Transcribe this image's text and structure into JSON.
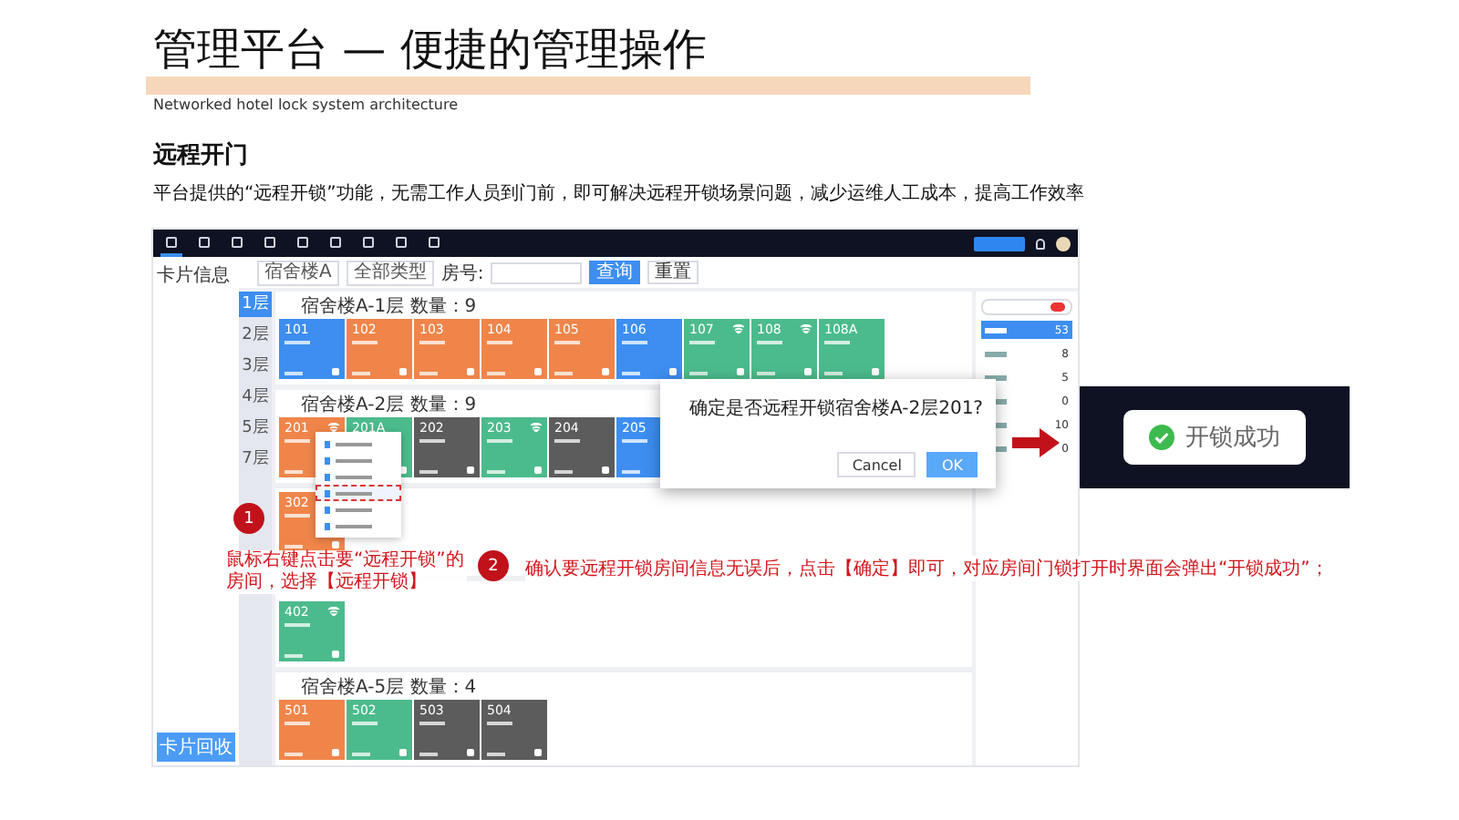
{
  "slide": {
    "title": "管理平台 — 便捷的管理操作",
    "subtitle": "Networked hotel lock system architecture",
    "section_title": "远程开门",
    "description": "平台提供的“远程开锁”功能，无需工作人员到门前，即可解决远程开锁场景问题，减少运维人工成本，提高工作效率"
  },
  "app": {
    "nav_items": [
      {
        "selected": true
      },
      {
        "selected": false
      },
      {
        "selected": false
      },
      {
        "selected": false
      },
      {
        "selected": false
      },
      {
        "selected": false
      },
      {
        "selected": false
      },
      {
        "selected": false
      },
      {
        "selected": false
      }
    ],
    "panel_label": "卡片信息",
    "bottom_button": "卡片回收",
    "filters": {
      "building": "宿舍楼A",
      "type": "全部类型",
      "room_label": "房号:",
      "search_button": "查询",
      "reset_button": "重置"
    },
    "floor_tabs": [
      {
        "label": "1层",
        "selected": true
      },
      {
        "label": "2层",
        "selected": false
      },
      {
        "label": "3层",
        "selected": false
      },
      {
        "label": "4层",
        "selected": false
      },
      {
        "label": "5层",
        "selected": false
      },
      {
        "label": "7层",
        "selected": false
      }
    ],
    "floors": [
      {
        "header": "宿舍楼A-1层 数量：9",
        "rooms": [
          {
            "number": "101",
            "color": "#3d8ef0",
            "wifi": false
          },
          {
            "number": "102",
            "color": "#f0854a",
            "wifi": false
          },
          {
            "number": "103",
            "color": "#f0854a",
            "wifi": false
          },
          {
            "number": "104",
            "color": "#f0854a",
            "wifi": false
          },
          {
            "number": "105",
            "color": "#f0854a",
            "wifi": false
          },
          {
            "number": "106",
            "color": "#3d8ef0",
            "wifi": false
          },
          {
            "number": "107",
            "color": "#4cbb8c",
            "wifi": true
          },
          {
            "number": "108",
            "color": "#4cbb8c",
            "wifi": true
          },
          {
            "number": "108A",
            "color": "#4cbb8c",
            "wifi": false
          }
        ]
      },
      {
        "header": "宿舍楼A-2层 数量：9",
        "rooms": [
          {
            "number": "201",
            "color": "#f0854a",
            "wifi": true
          },
          {
            "number": "201A",
            "color": "#4cbb8c",
            "wifi": false
          },
          {
            "number": "202",
            "color": "#5c5c5c",
            "wifi": false
          },
          {
            "number": "203",
            "color": "#4cbb8c",
            "wifi": true
          },
          {
            "number": "204",
            "color": "#5c5c5c",
            "wifi": false
          },
          {
            "number": "205",
            "color": "#3d8ef0"
          }
        ]
      },
      {
        "rooms": [
          {
            "number": "302",
            "color": "#f0854a"
          }
        ]
      },
      {
        "rooms": [
          {
            "number": "402",
            "color": "#4cbb8c",
            "wifi": true
          }
        ]
      },
      {
        "header": "宿舍楼A-5层 数量：4",
        "rooms": [
          {
            "number": "501",
            "color": "#f0854a",
            "wifi": false
          },
          {
            "number": "502",
            "color": "#4cbb8c",
            "wifi": false
          },
          {
            "number": "503",
            "color": "#5c5c5c",
            "wifi": false
          },
          {
            "number": "504",
            "color": "#5c5c5c",
            "wifi": false
          }
        ]
      }
    ],
    "status_counts": [
      {
        "count": "53",
        "selected": true
      },
      {
        "count": "8",
        "selected": false
      },
      {
        "count": "5",
        "selected": false
      },
      {
        "count": "0",
        "selected": false
      },
      {
        "count": "10",
        "selected": false
      },
      {
        "count": "0",
        "selected": false
      }
    ],
    "context_menu": [
      {
        "selected": false
      },
      {
        "selected": false
      },
      {
        "selected": false
      },
      {
        "selected": true
      },
      {
        "selected": false
      },
      {
        "selected": false
      }
    ],
    "dialog": {
      "message": "确定是否远程开锁宿舍楼A-2层201?",
      "cancel": "Cancel",
      "ok": "OK"
    }
  },
  "toast": {
    "message": "开锁成功"
  },
  "steps": [
    {
      "number": "1",
      "text": "鼠标右键点击要“远程开锁”的房间，选择【远程开锁】"
    },
    {
      "number": "2",
      "text": "确认要远程开锁房间信息无误后，点击【确定】即可，对应房间门锁打开时界面会弹出“开锁成功”；"
    }
  ]
}
